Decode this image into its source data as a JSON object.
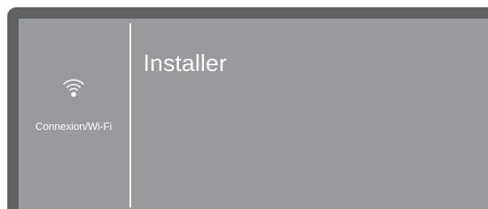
{
  "sidebar": {
    "icon": "wifi-icon",
    "label": "Connexion/Wi-Fi"
  },
  "main": {
    "title": "Installer"
  },
  "colors": {
    "frame": "#5f6063",
    "screen": "#9a9a9d",
    "text": "#ffffff"
  }
}
